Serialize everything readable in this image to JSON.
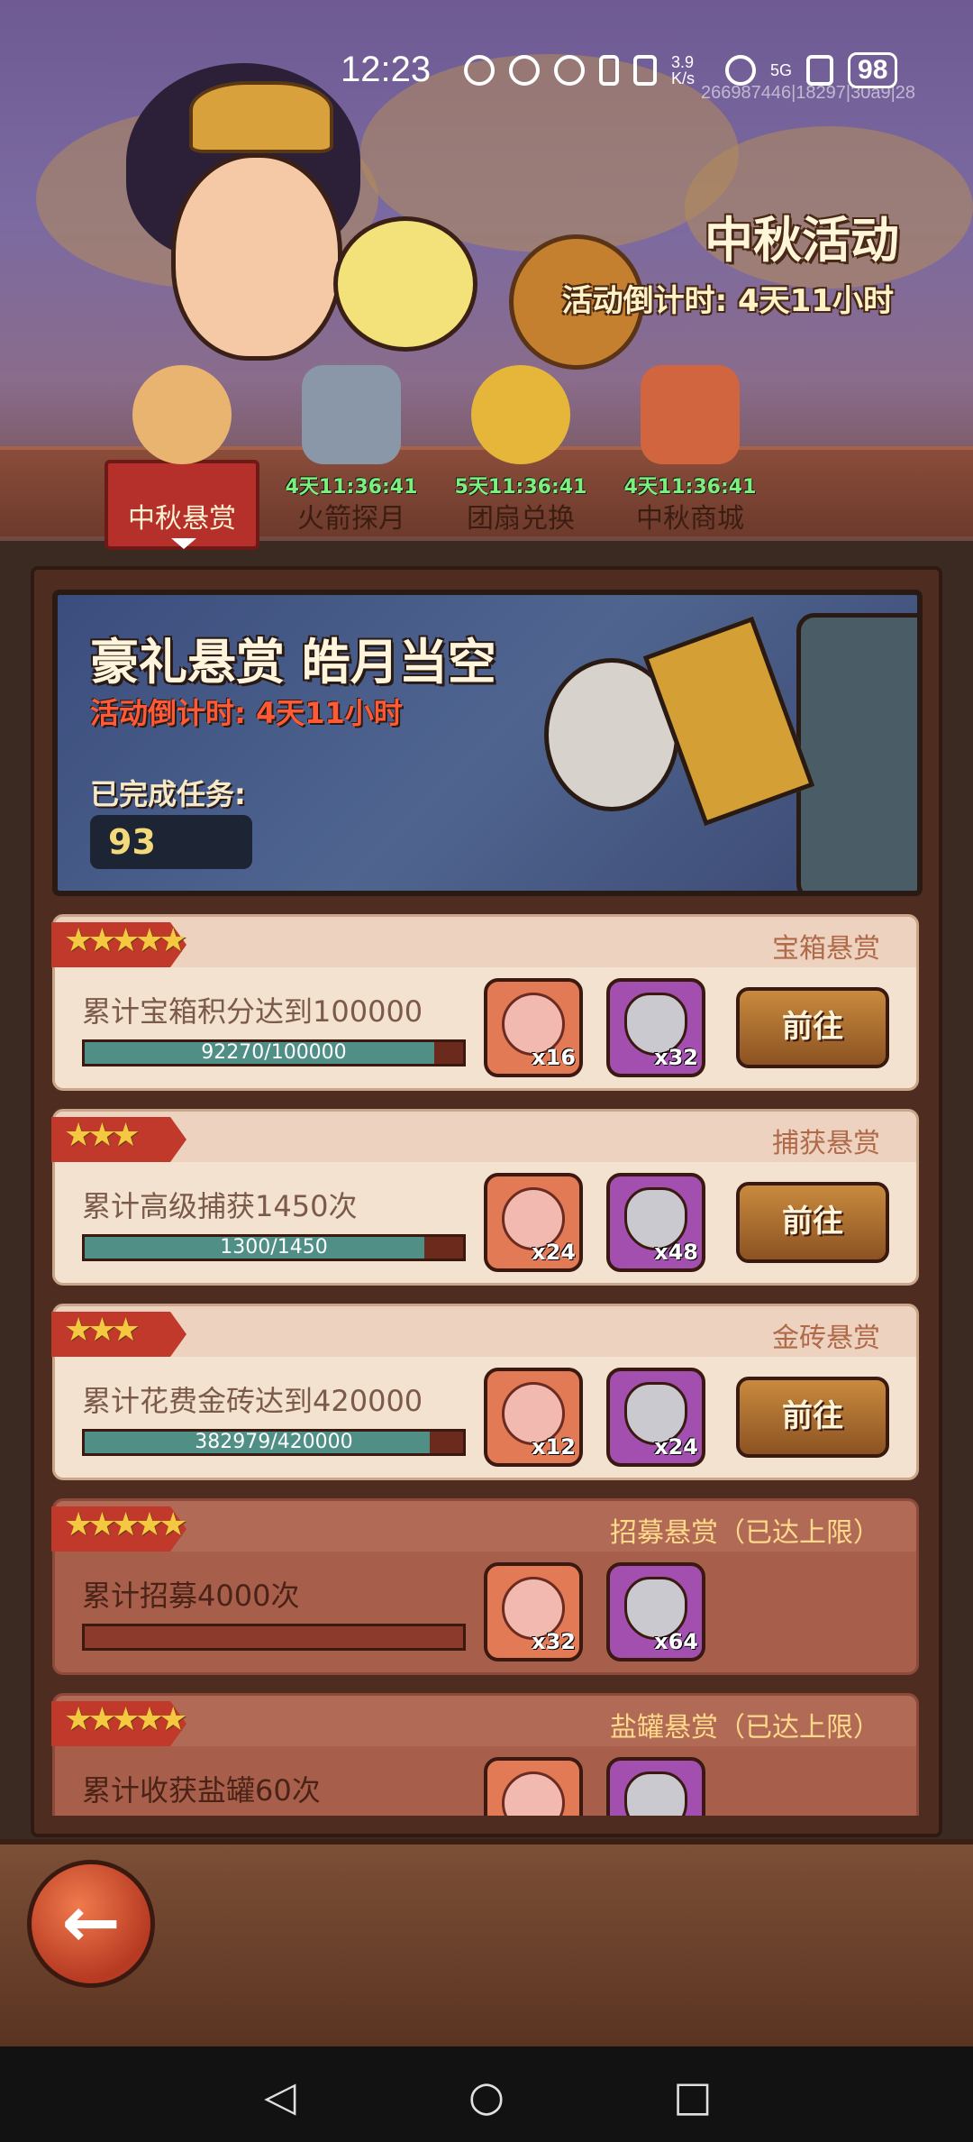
{
  "status_bar": {
    "time": "12:23",
    "net_speed": "3.9 K/s",
    "network": "5G",
    "battery": "98",
    "device_id": "266987446|18297|30a9|28"
  },
  "header": {
    "event_title": "中秋活动",
    "event_countdown": "活动倒计时: 4天11小时"
  },
  "tabs": [
    {
      "label": "中秋悬赏",
      "timer": "",
      "active": true
    },
    {
      "label": "火箭探月",
      "timer": "4天11:36:41",
      "active": false
    },
    {
      "label": "团扇兑换",
      "timer": "5天11:36:41",
      "active": false
    },
    {
      "label": "中秋商城",
      "timer": "4天11:36:41",
      "active": false
    }
  ],
  "hero": {
    "title": "豪礼悬赏 皓月当空",
    "countdown": "活动倒计时: 4天11小时",
    "completed_label": "已完成任务:",
    "completed_value": "93"
  },
  "tasks": [
    {
      "stars": "★★★★★",
      "category": "宝箱悬赏",
      "desc": "累计宝箱积分达到100000",
      "progress_text": "92270/100000",
      "progress": 0.9227,
      "reward1": "x16",
      "reward2": "x32",
      "button": "前往",
      "maxed": false
    },
    {
      "stars": "★★★",
      "category": "捕获悬赏",
      "desc": "累计高级捕获1450次",
      "progress_text": "1300/1450",
      "progress": 0.8966,
      "reward1": "x24",
      "reward2": "x48",
      "button": "前往",
      "maxed": false
    },
    {
      "stars": "★★★",
      "category": "金砖悬赏",
      "desc": "累计花费金砖达到420000",
      "progress_text": "382979/420000",
      "progress": 0.9119,
      "reward1": "x12",
      "reward2": "x24",
      "button": "前往",
      "maxed": false
    },
    {
      "stars": "★★★★★",
      "category": "招募悬赏（已达上限）",
      "desc": "累计招募4000次",
      "progress_text": "",
      "progress": 0,
      "reward1": "x32",
      "reward2": "x64",
      "button": "",
      "maxed": true
    },
    {
      "stars": "★★★★★",
      "category": "盐罐悬赏（已达上限）",
      "desc": "累计收获盐罐60次",
      "progress_text": "",
      "progress": 0,
      "reward1": "",
      "reward2": "",
      "button": "",
      "maxed": true
    }
  ],
  "footer": {
    "back_icon": "←"
  },
  "navbar": {
    "back": "◁",
    "home": "○",
    "recents": "□"
  }
}
